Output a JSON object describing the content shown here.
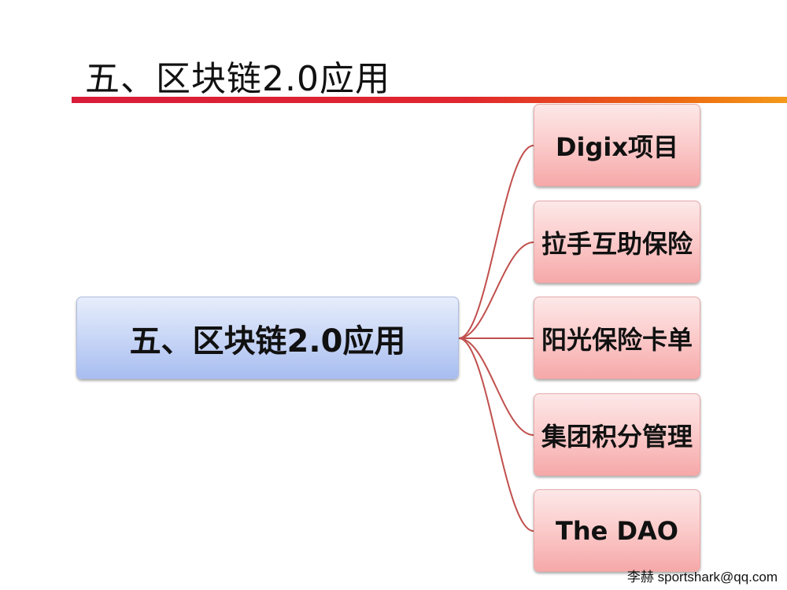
{
  "title": "五、区块链2.0应用",
  "diagram": {
    "root": "五、区块链2.0应用",
    "children": [
      "Digix项目",
      "拉手互助保险",
      "阳光保险卡单",
      "集团积分管理",
      "The DAO"
    ]
  },
  "footer": "李赫 sportshark@qq.com",
  "colors": {
    "title_rule_start": "#d91c3a",
    "title_rule_end": "#f39a1a",
    "root_fill": "#c8d6f6",
    "child_fill": "#fbcaca",
    "connector": "#c0504d"
  }
}
